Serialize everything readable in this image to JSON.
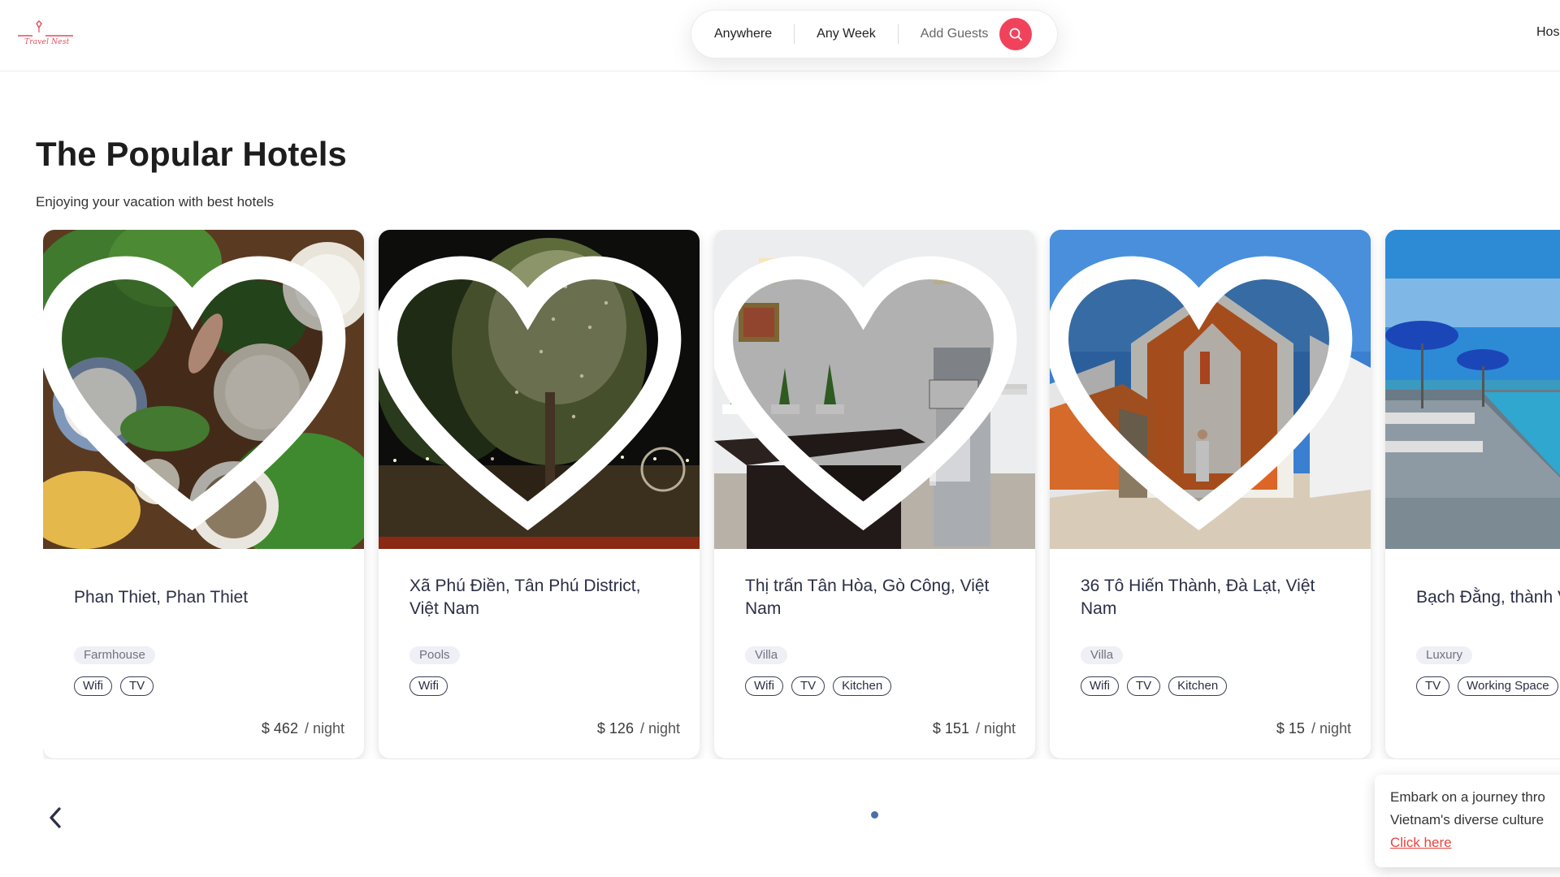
{
  "header": {
    "logo_text": "Travel Nest",
    "search": {
      "location": "Anywhere",
      "week": "Any Week",
      "guests": "Add Guests"
    },
    "host_link": "Hos"
  },
  "section": {
    "title": "The Popular Hotels",
    "subtitle": "Enjoying your vacation with best hotels"
  },
  "hotels": [
    {
      "title": "Phan Thiet, Phan Thiet",
      "type": "Farmhouse",
      "amenities": [
        "Wifi",
        "TV"
      ],
      "price": "$ 462",
      "unit": "/ night"
    },
    {
      "title": "Xã Phú Điền, Tân Phú District, Việt Nam",
      "type": "Pools",
      "amenities": [
        "Wifi"
      ],
      "price": "$ 126",
      "unit": "/ night"
    },
    {
      "title": "Thị trấn Tân Hòa, Gò Công, Việt Nam",
      "type": "Villa",
      "amenities": [
        "Wifi",
        "TV",
        "Kitchen"
      ],
      "price": "$ 151",
      "unit": "/ night"
    },
    {
      "title": "36 Tô Hiến Thành, Đà Lạt, Việt Nam",
      "type": "Villa",
      "amenities": [
        "Wifi",
        "TV",
        "Kitchen"
      ],
      "price": "$ 15",
      "unit": "/ night"
    },
    {
      "title": "Bạch Đằng, thành Việt Nam",
      "type": "Luxury",
      "amenities": [
        "TV",
        "Working Space"
      ],
      "price": "",
      "unit": ""
    }
  ],
  "promo": {
    "line1": "Embark on a journey thro",
    "line2": "Vietnam's diverse culture",
    "link": "Click here"
  },
  "colors": {
    "brand": "#f0435b",
    "pager_dot": "#4e6fa8",
    "link": "#e8443f"
  },
  "icons": {
    "search": "search-icon",
    "favorite": "heart-icon",
    "prev": "chevron-left-icon"
  }
}
